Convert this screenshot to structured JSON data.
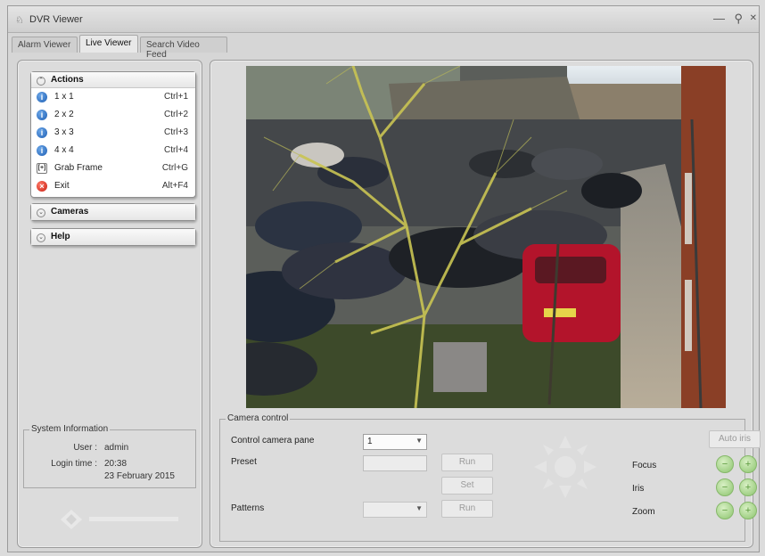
{
  "window": {
    "title": "DVR Viewer",
    "app_icon": "tree-icon"
  },
  "tabs": [
    {
      "label": "Alarm Viewer",
      "active": false
    },
    {
      "label": "Live Viewer",
      "active": true
    },
    {
      "label": "Search Video Feed",
      "active": false
    }
  ],
  "sidebar": {
    "actions": {
      "header": "Actions",
      "items": [
        {
          "label": "1 x 1",
          "shortcut": "Ctrl+1",
          "icon": "info-icon"
        },
        {
          "label": "2 x 2",
          "shortcut": "Ctrl+2",
          "icon": "info-icon"
        },
        {
          "label": "3 x 3",
          "shortcut": "Ctrl+3",
          "icon": "info-icon"
        },
        {
          "label": "4 x 4",
          "shortcut": "Ctrl+4",
          "icon": "info-icon"
        },
        {
          "label": "Grab Frame",
          "shortcut": "Ctrl+G",
          "icon": "grab-frame-icon"
        },
        {
          "label": "Exit",
          "shortcut": "Alt+F4",
          "icon": "exit-icon"
        }
      ]
    },
    "cameras_header": "Cameras",
    "help_header": "Help"
  },
  "system_info": {
    "legend": "System Information",
    "user_label": "User :",
    "user_value": "admin",
    "login_label": "Login time :",
    "login_time": "20:38",
    "login_date": "23 February 2015"
  },
  "camera_control": {
    "legend": "Camera control",
    "control_pane_label": "Control camera pane",
    "control_pane_value": "1",
    "preset_label": "Preset",
    "patterns_label": "Patterns",
    "run_label": "Run",
    "set_label": "Set",
    "auto_iris_label": "Auto iris",
    "focus_label": "Focus",
    "iris_label": "Iris",
    "zoom_label": "Zoom"
  },
  "colors": {
    "accent_green": "#8cc46e",
    "info_blue": "#1f5fb3",
    "exit_red": "#c81b0e"
  }
}
